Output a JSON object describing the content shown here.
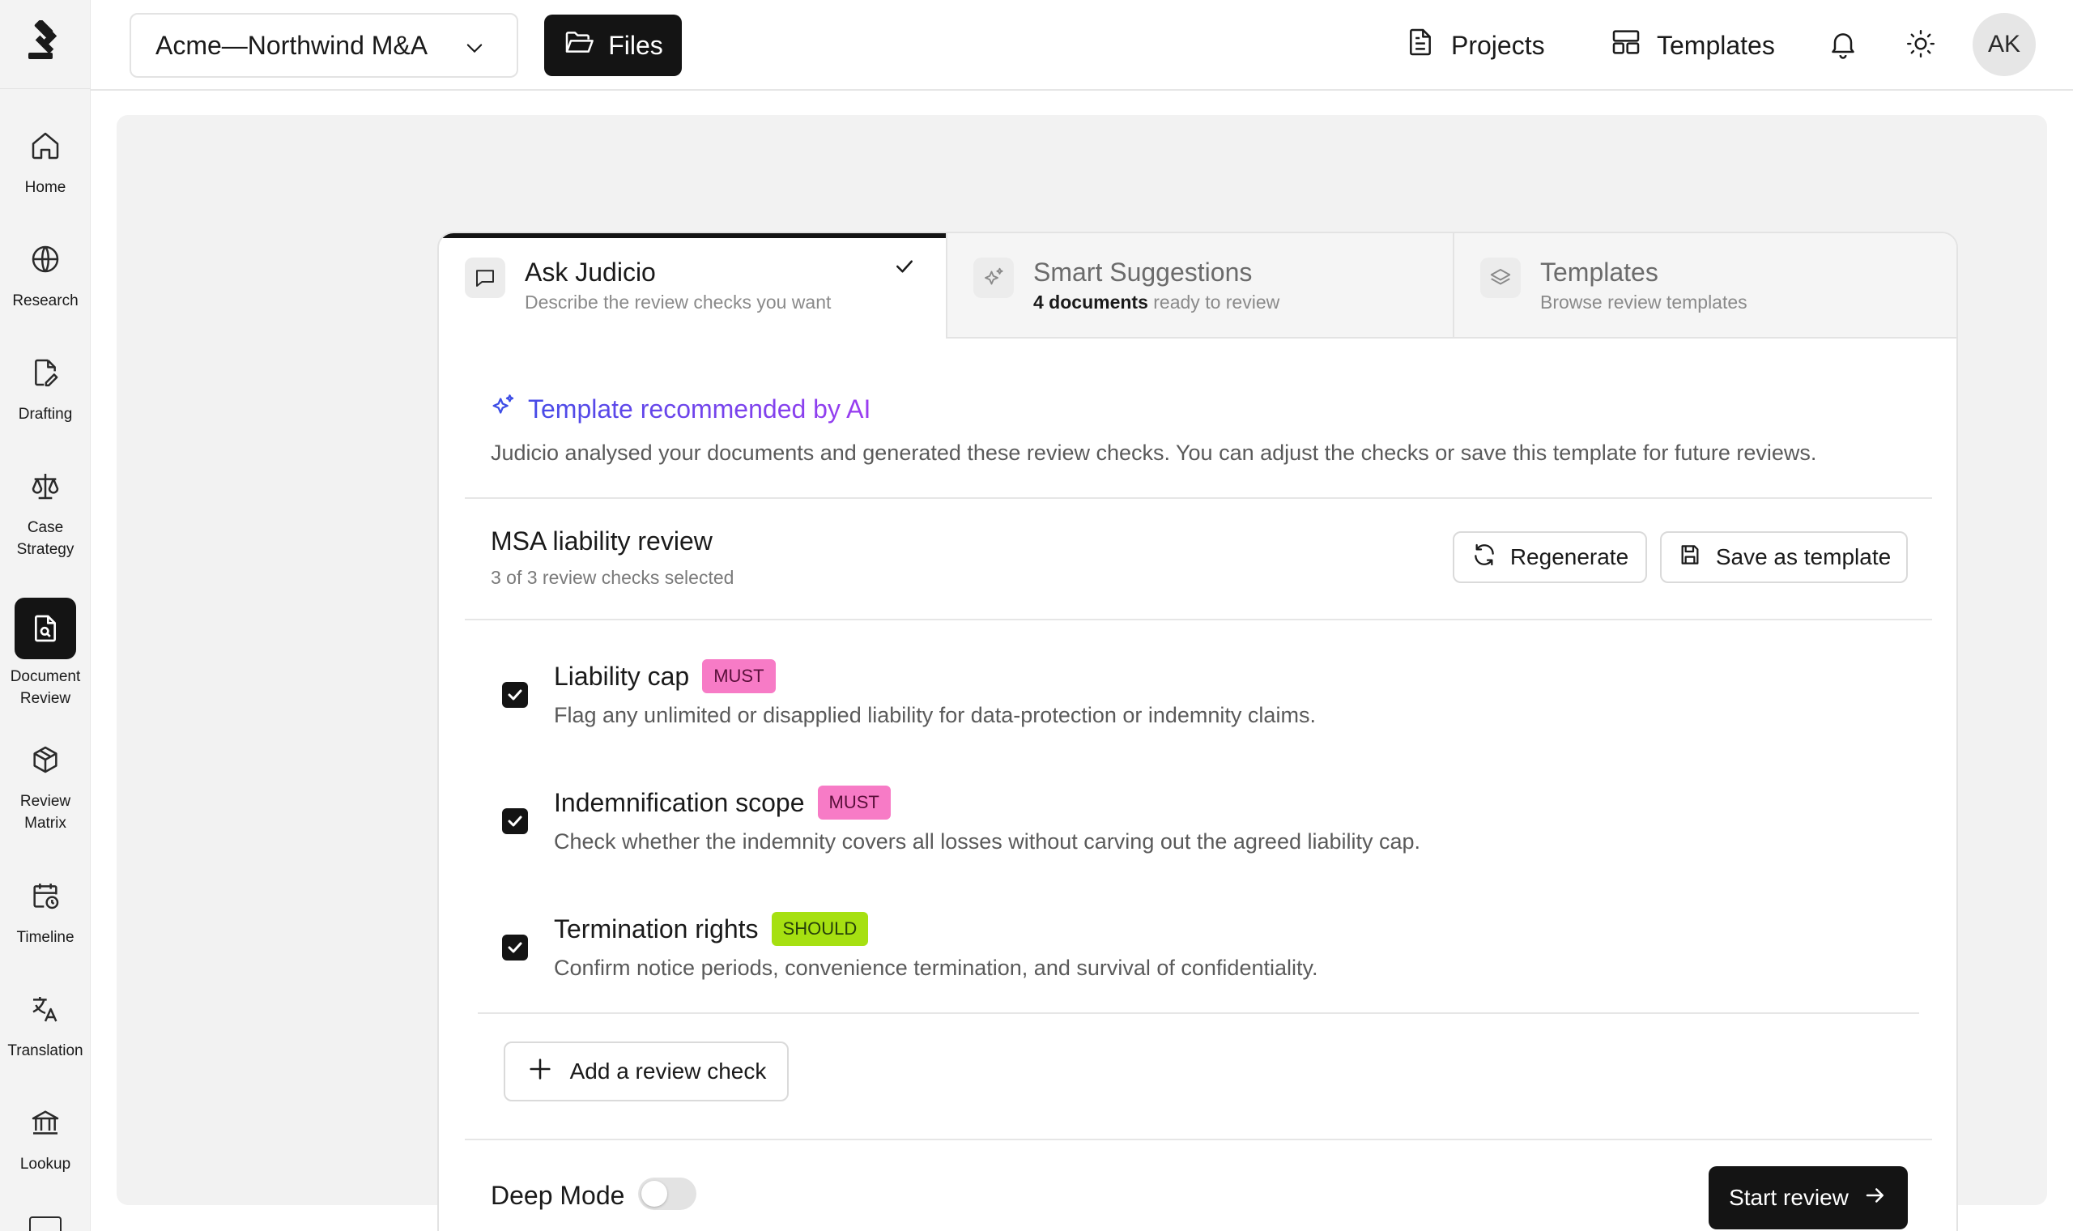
{
  "sidebar": {
    "logo_icon": "gavel-icon",
    "items": [
      {
        "label": "Home",
        "icon": "home-icon"
      },
      {
        "label": "Research",
        "icon": "globe-icon"
      },
      {
        "label": "Drafting",
        "icon": "file-pen-icon"
      },
      {
        "label": "Case Strategy",
        "icon": "scales-icon"
      },
      {
        "label": "Document Review",
        "icon": "file-search-icon",
        "active": true
      },
      {
        "label": "Review Matrix",
        "icon": "cube-icon"
      },
      {
        "label": "Timeline",
        "icon": "calendar-clock-icon"
      },
      {
        "label": "Translation",
        "icon": "translate-icon"
      },
      {
        "label": "Lookup",
        "icon": "bank-icon"
      }
    ]
  },
  "topbar": {
    "project": "Acme—Northwind M&A",
    "files_label": "Files",
    "projects_label": "Projects",
    "templates_label": "Templates",
    "avatar": "AK"
  },
  "tabs": [
    {
      "title": "Ask Judicio",
      "subtitle": "Describe the review checks you want",
      "active": true
    },
    {
      "title": "Smart Suggestions",
      "subtitle_bold": "4 documents",
      "subtitle": " ready to review",
      "active": false
    },
    {
      "title": "Templates",
      "subtitle": "Browse review templates",
      "active": false
    }
  ],
  "recommendation": {
    "title": "Template recommended by AI",
    "description": "Judicio analysed your documents and generated these review checks. You can adjust the checks or save this template for future reviews."
  },
  "review": {
    "name": "MSA liability review",
    "count": "3 of 3 review checks selected",
    "regenerate_label": "Regenerate",
    "save_template_label": "Save as template"
  },
  "checks": [
    {
      "title": "Liability cap",
      "badge": "MUST",
      "description": "Flag any unlimited or disapplied liability for data-protection or indemnity claims.",
      "checked": true
    },
    {
      "title": "Indemnification scope",
      "badge": "MUST",
      "description": "Check whether the indemnity covers all losses without carving out the agreed liability cap.",
      "checked": true
    },
    {
      "title": "Termination rights",
      "badge": "SHOULD",
      "description": "Confirm notice periods, convenience termination, and survival of confidentiality.",
      "checked": true
    }
  ],
  "add_check_label": "Add a review check",
  "footer": {
    "deep_mode_label": "Deep Mode",
    "deep_mode_on": false,
    "start_label": "Start review"
  }
}
